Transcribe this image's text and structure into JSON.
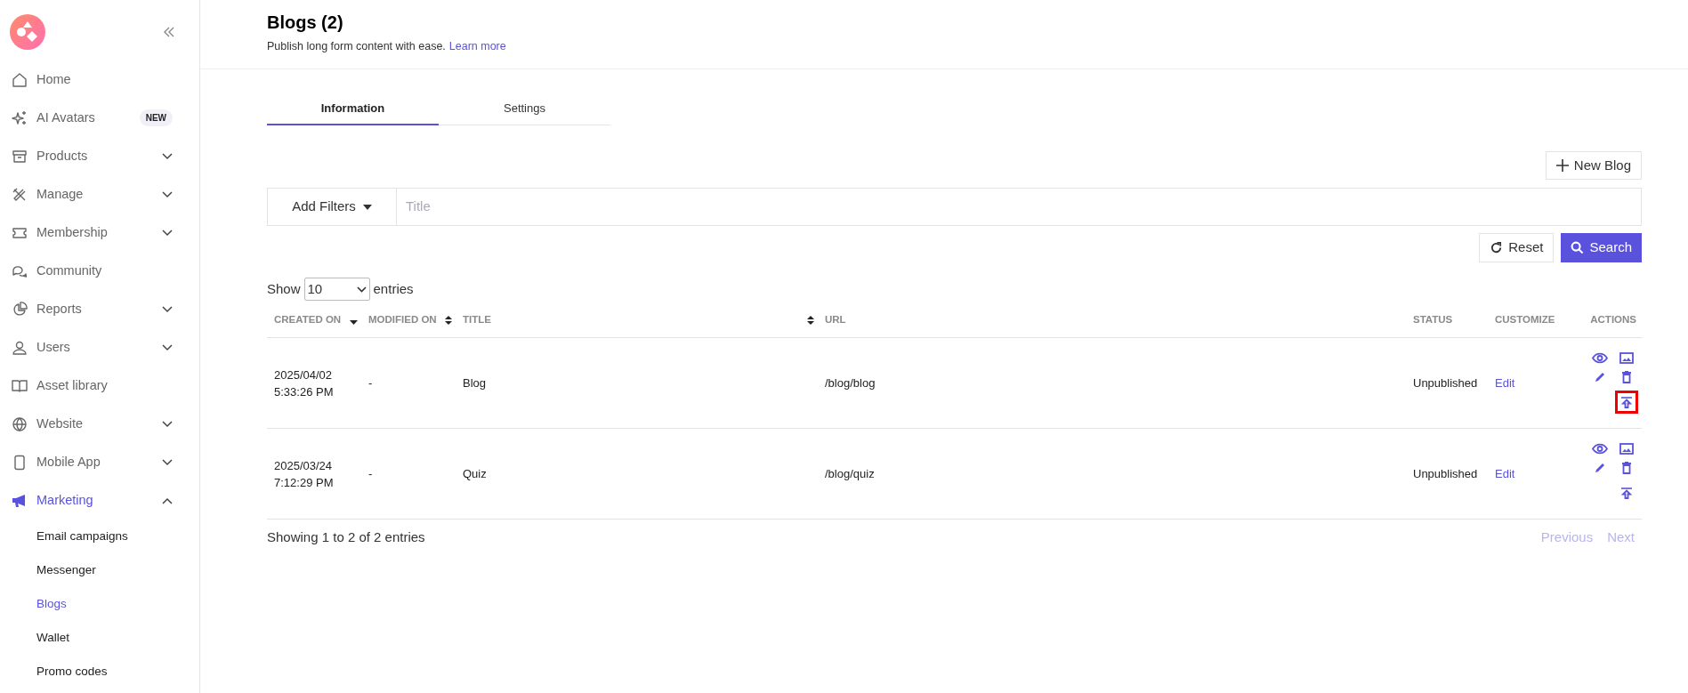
{
  "sidebar": {
    "items": [
      {
        "label": "Home",
        "selected": false
      },
      {
        "label": "AI Avatars",
        "selected": false,
        "badge": "NEW"
      },
      {
        "label": "Products",
        "selected": false,
        "expanded": false
      },
      {
        "label": "Manage",
        "selected": false,
        "expanded": false
      },
      {
        "label": "Membership",
        "selected": false,
        "expanded": false
      },
      {
        "label": "Community",
        "selected": false
      },
      {
        "label": "Reports",
        "selected": false,
        "expanded": false
      },
      {
        "label": "Users",
        "selected": false,
        "expanded": false
      },
      {
        "label": "Asset library",
        "selected": false
      },
      {
        "label": "Website",
        "selected": false,
        "expanded": false
      },
      {
        "label": "Mobile App",
        "selected": false,
        "expanded": false
      },
      {
        "label": "Marketing",
        "selected": true,
        "expanded": true,
        "children": [
          {
            "label": "Email campaigns",
            "selected": false
          },
          {
            "label": "Messenger",
            "selected": false
          },
          {
            "label": "Blogs",
            "selected": true
          },
          {
            "label": "Wallet",
            "selected": false
          },
          {
            "label": "Promo codes",
            "selected": false
          }
        ]
      }
    ]
  },
  "header": {
    "title": "Blogs (2)",
    "subtitle": "Publish long form content with ease.",
    "link": "Learn more"
  },
  "tabs": [
    {
      "label": "Information",
      "selected": true
    },
    {
      "label": "Settings",
      "selected": false
    }
  ],
  "new_button": "New Blog",
  "filters": {
    "button": "Add Filters",
    "placeholder": "Title"
  },
  "reset_button": "Reset",
  "search_button": "Search",
  "page_size": {
    "before": "Show",
    "value": "10",
    "after": "entries"
  },
  "table": {
    "columns": [
      {
        "label": "CREATED ON",
        "sortable": true,
        "sorted": true
      },
      {
        "label": "MODIFIED ON",
        "sortable": true,
        "sorted": false
      },
      {
        "label": "TITLE",
        "sortable": true,
        "sorted": false
      },
      {
        "label": "URL"
      },
      {
        "label": "STATUS"
      },
      {
        "label": "CUSTOMIZE"
      },
      {
        "label": "ACTIONS"
      }
    ],
    "rows": [
      {
        "created_date": "2025/04/02",
        "created_time": "5:33:26 PM",
        "modified_on": "-",
        "title": "Blog",
        "url": "/blog/blog",
        "status": "Unpublished",
        "customize": "Edit",
        "publish_highlighted": true
      },
      {
        "created_date": "2025/03/24",
        "created_time": "7:12:29 PM",
        "modified_on": "-",
        "title": "Quiz",
        "url": "/blog/quiz",
        "status": "Unpublished",
        "customize": "Edit",
        "publish_highlighted": false
      }
    ]
  },
  "footer": {
    "summary": "Showing 1 to 2 of 2 entries",
    "previous": {
      "label": "Previous",
      "disabled": true
    },
    "next": {
      "label": "Next",
      "disabled": true
    }
  }
}
